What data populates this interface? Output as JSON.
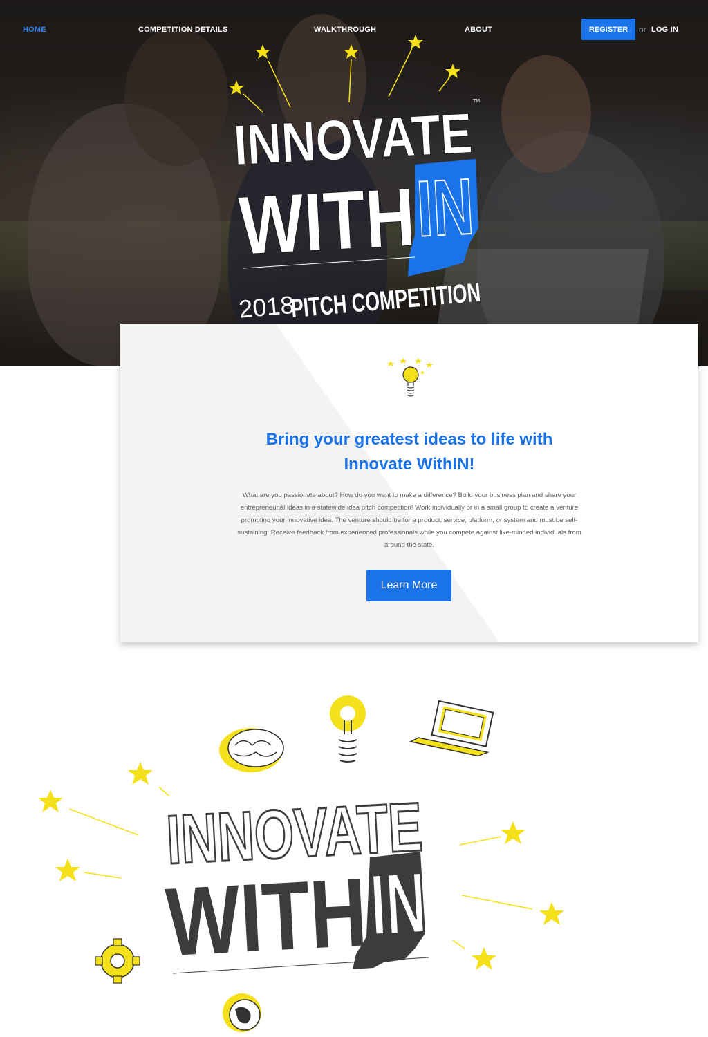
{
  "nav": {
    "home": "HOME",
    "competition_details": "COMPETITION DETAILS",
    "walkthrough": "WALKTHROUGH",
    "about": "ABOUT",
    "register": "REGISTER",
    "or": "or",
    "login": "LOG IN"
  },
  "hero": {
    "logo_line1": "INNOVATE",
    "logo_line2": "WITH",
    "logo_in": "IN",
    "tm": "TM",
    "subtitle_year": "2018",
    "subtitle": "PITCH COMPETITION"
  },
  "intro": {
    "heading_line1": "Bring your greatest ideas to life with",
    "heading_line2": "Innovate WithIN!",
    "body": "What are you passionate about? How do you want to make a difference? Build your business plan and share your entrepreneurial ideas in a statewide idea pitch competition! Work individually or in a small group to create a venture promoting your innovative idea. The venture should be for a product, service, platform, or system and must be self-sustaining. Receive feedback from experienced professionals while you compete against like-minded individuals from around the state.",
    "button": "Learn More"
  },
  "bottom_logo": {
    "line1": "INNOVATE",
    "line2": "WITH",
    "in": "IN"
  },
  "colors": {
    "accent_blue": "#1a73e8",
    "star_yellow": "#f5e11b",
    "logo_dark": "#3c3c3c"
  },
  "icons": [
    "star-icon",
    "lightbulb-icon",
    "brain-icon",
    "laptop-icon",
    "gear-icon",
    "globe-icon",
    "indiana-state-icon"
  ]
}
